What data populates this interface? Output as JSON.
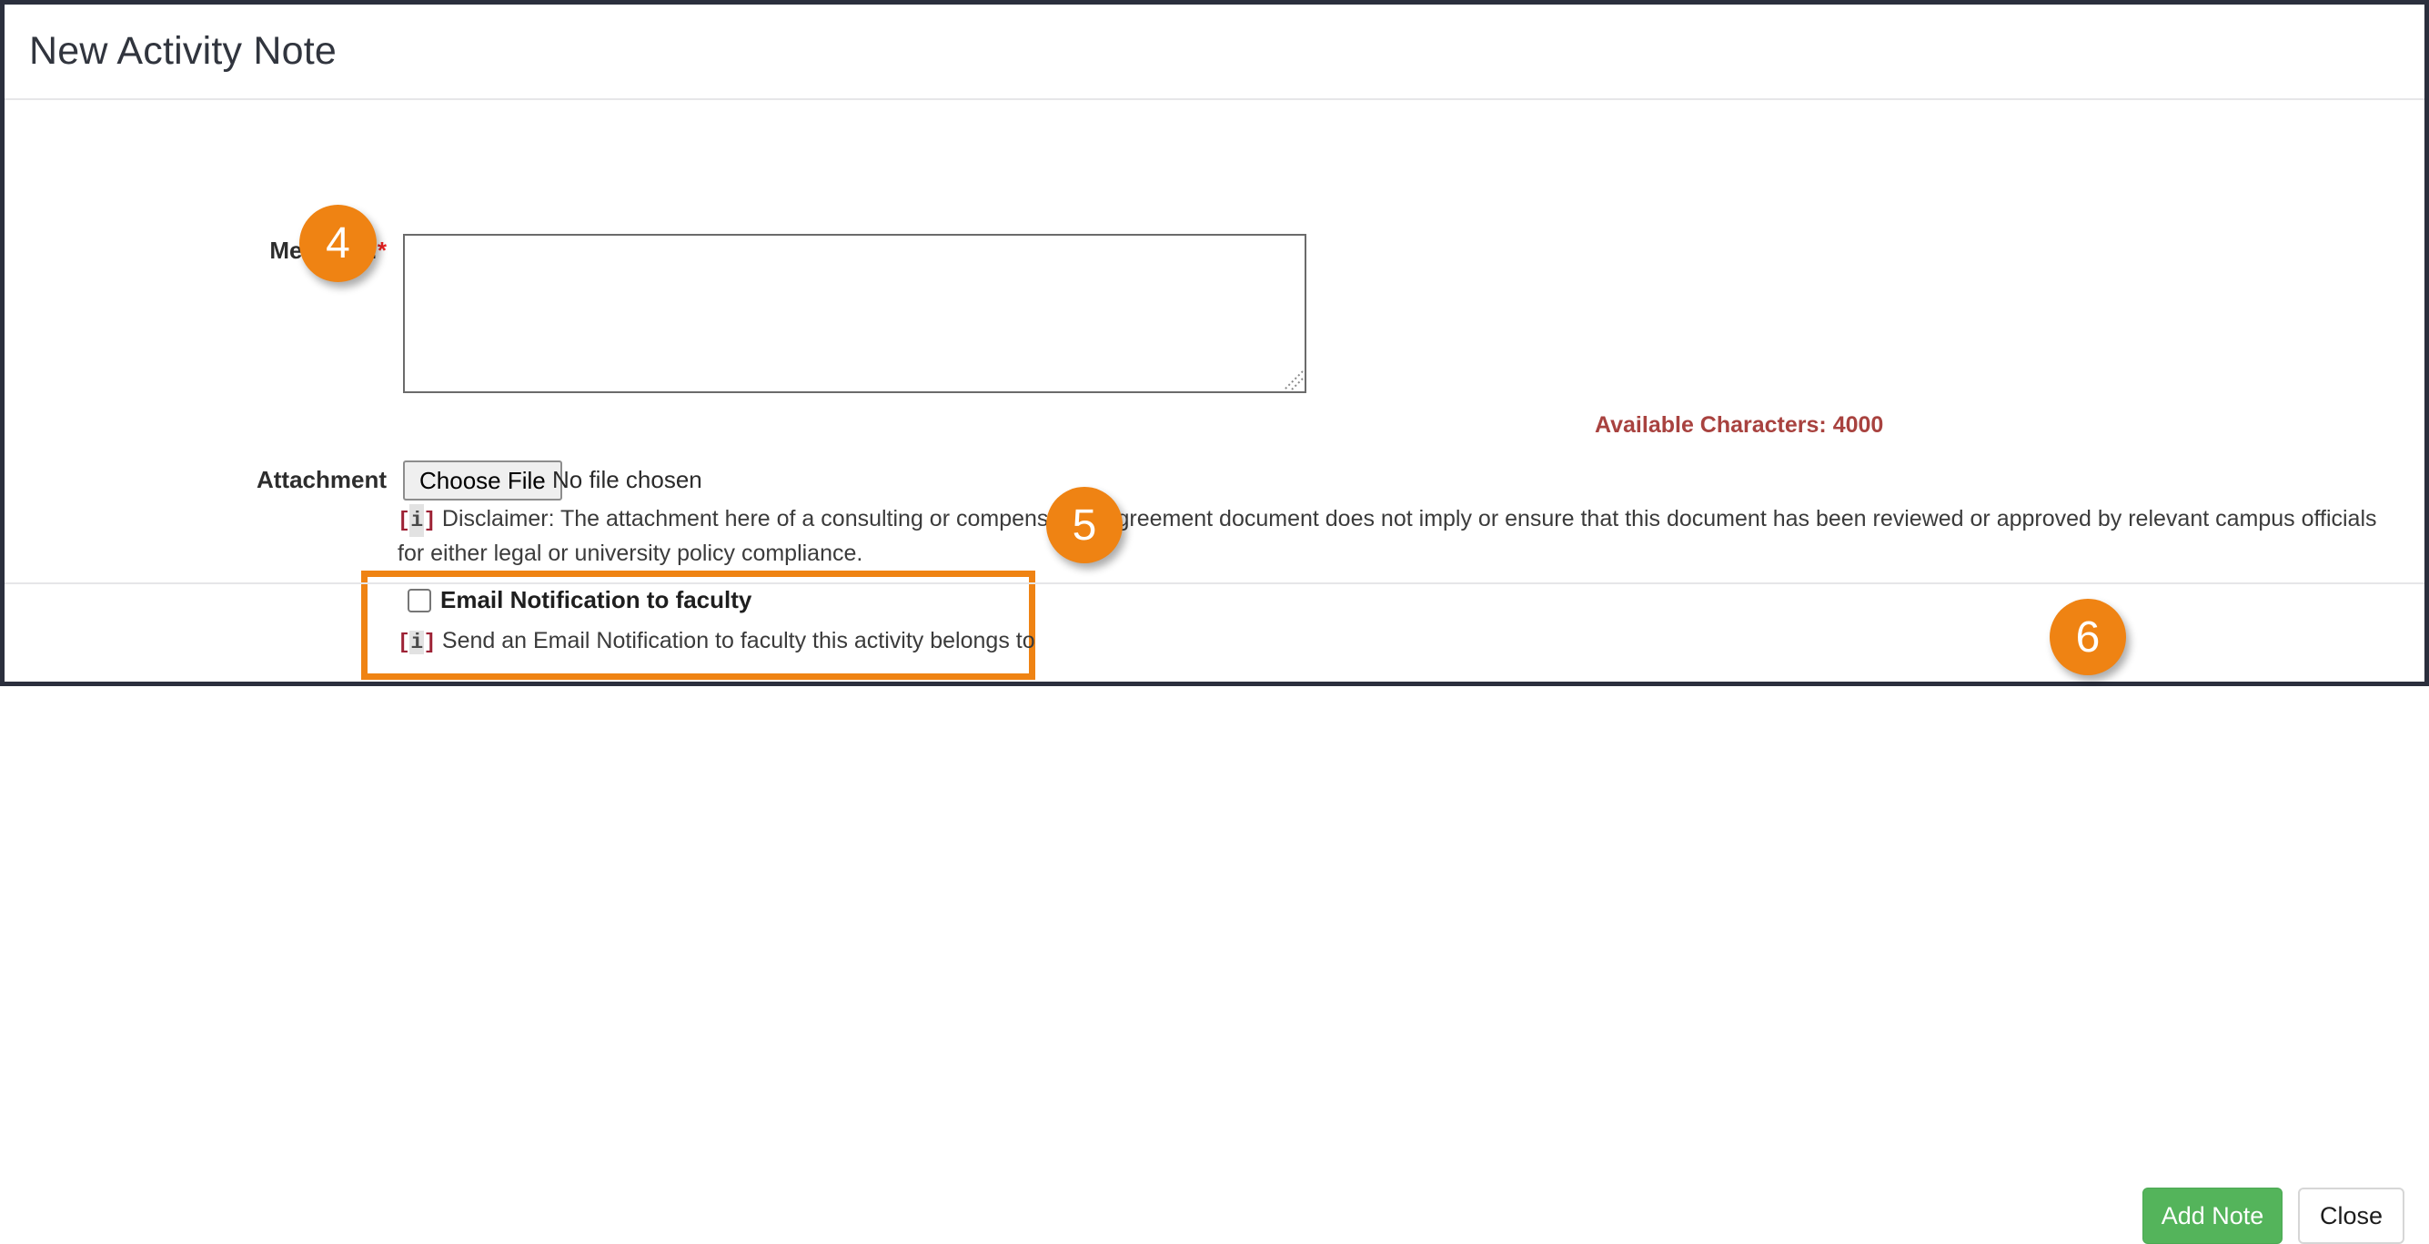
{
  "header": {
    "title": "New Activity Note"
  },
  "form": {
    "message": {
      "label": "Message:",
      "required_marker": "*",
      "value": "",
      "placeholder": ""
    },
    "available_characters": {
      "text": "Available Characters: 4000",
      "count": 4000,
      "color": "#a8423f"
    },
    "attachment": {
      "label": "Attachment",
      "choose_file_label": "Choose File",
      "file_status": "No file chosen",
      "disclaimer_tag": "[i]",
      "disclaimer_text": "Disclaimer: The attachment here of a consulting or compensation agreement document does not imply or ensure that this document has been reviewed or approved by relevant campus officials for either legal or university policy compliance."
    },
    "email_notification": {
      "checkbox_label": "Email Notification to faculty",
      "checked": false,
      "help_tag": "[i]",
      "help_text": "Send an Email Notification to faculty this activity belongs to"
    }
  },
  "footer": {
    "add_note_label": "Add Note",
    "close_label": "Close"
  },
  "annotations": {
    "badges": [
      {
        "number": "4",
        "target": "message-textarea"
      },
      {
        "number": "5",
        "target": "email-notification-checkbox"
      },
      {
        "number": "6",
        "target": "add-note-button"
      }
    ],
    "highlight_color": "#ef8313"
  }
}
